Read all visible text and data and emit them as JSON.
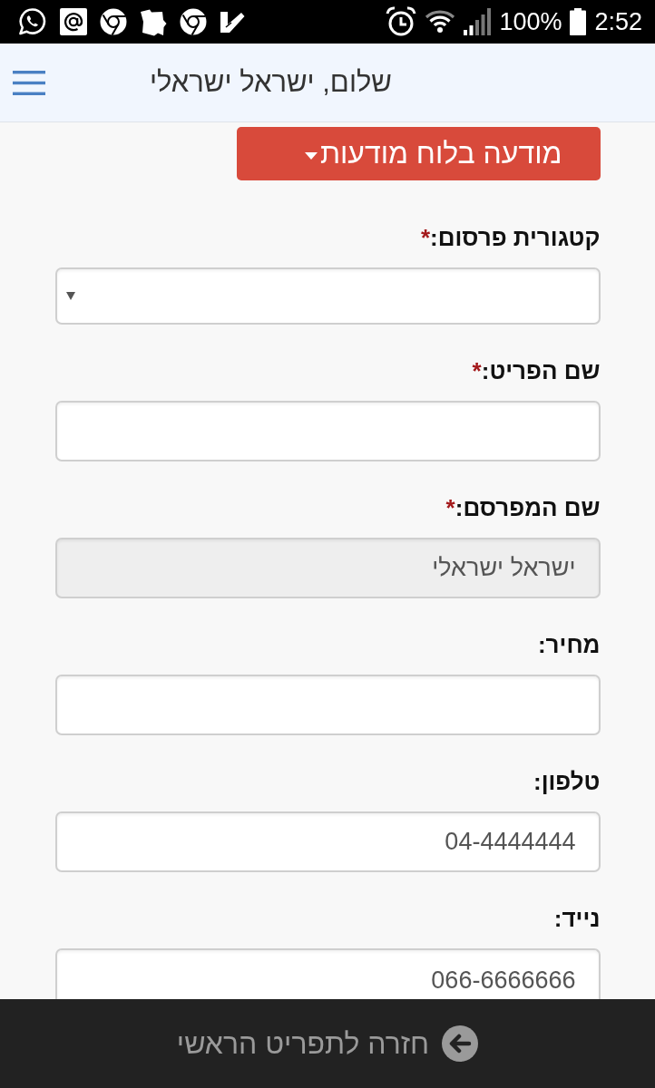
{
  "status_bar": {
    "battery": "100%",
    "time": "2:52"
  },
  "header": {
    "title": "שלום, ישראל ישראלי"
  },
  "dropdown_button": {
    "label": "מודעה בלוח מודעות"
  },
  "form": {
    "fields": [
      {
        "kind": "select",
        "label": "קטגורית פרסום:",
        "required_mark": "*",
        "disabled": false
      },
      {
        "kind": "text",
        "label": "שם הפריט:",
        "required_mark": "*",
        "disabled": false
      },
      {
        "kind": "text",
        "label": "שם המפרסם:",
        "required_mark": "*",
        "disabled": true,
        "value": "ישראל ישראלי"
      },
      {
        "kind": "text",
        "label": "מחיר:",
        "disabled": false
      },
      {
        "kind": "text",
        "label": "טלפון:",
        "disabled": false,
        "value": "04-4444444"
      },
      {
        "kind": "text",
        "label": "נייד:",
        "disabled": false,
        "value": "066-6666666"
      }
    ]
  },
  "footer": {
    "back_link": "חזרה לתפריט הראשי"
  }
}
